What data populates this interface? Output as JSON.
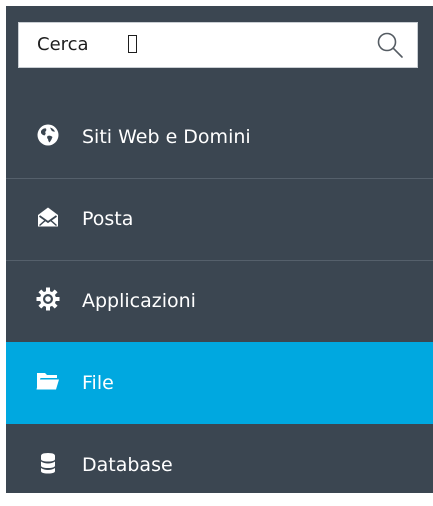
{
  "search": {
    "value": "Cerca",
    "placeholder": ""
  },
  "nav": {
    "items": [
      {
        "label": "Siti Web e Domini",
        "icon": "globe-icon",
        "active": false
      },
      {
        "label": "Posta",
        "icon": "mail-icon",
        "active": false
      },
      {
        "label": "Applicazioni",
        "icon": "gear-icon",
        "active": false
      },
      {
        "label": "File",
        "icon": "folder-icon",
        "active": true
      },
      {
        "label": "Database",
        "icon": "database-icon",
        "active": false
      }
    ]
  },
  "colors": {
    "sidebar_bg": "#3b4651",
    "divider": "#55606b",
    "active_bg": "#00a8e0",
    "text": "#ffffff"
  }
}
